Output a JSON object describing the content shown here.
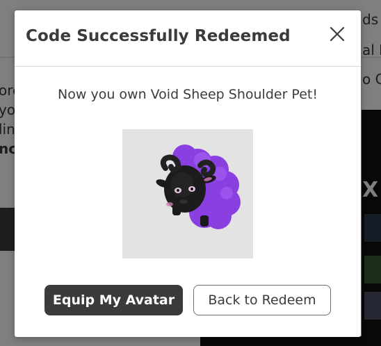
{
  "background": {
    "left_fragments": [
      "ore",
      "yo",
      "lin",
      "nc"
    ],
    "right_fragments": [
      "ds",
      "al I",
      "o C"
    ],
    "banner_text": "X"
  },
  "modal": {
    "title": "Code Successfully Redeemed",
    "close_icon": "close-icon",
    "message": "Now you own Void Sheep Shoulder Pet!",
    "item_image": "void-sheep-shoulder-pet-image",
    "primary_button": "Equip My Avatar",
    "secondary_button": "Back to Redeem"
  },
  "colors": {
    "overlay": "#000000",
    "primary_button_bg": "#393b3d",
    "text": "#393b3d",
    "sheep_wool": "#8a3fe0",
    "sheep_body": "#1a1a1a"
  }
}
